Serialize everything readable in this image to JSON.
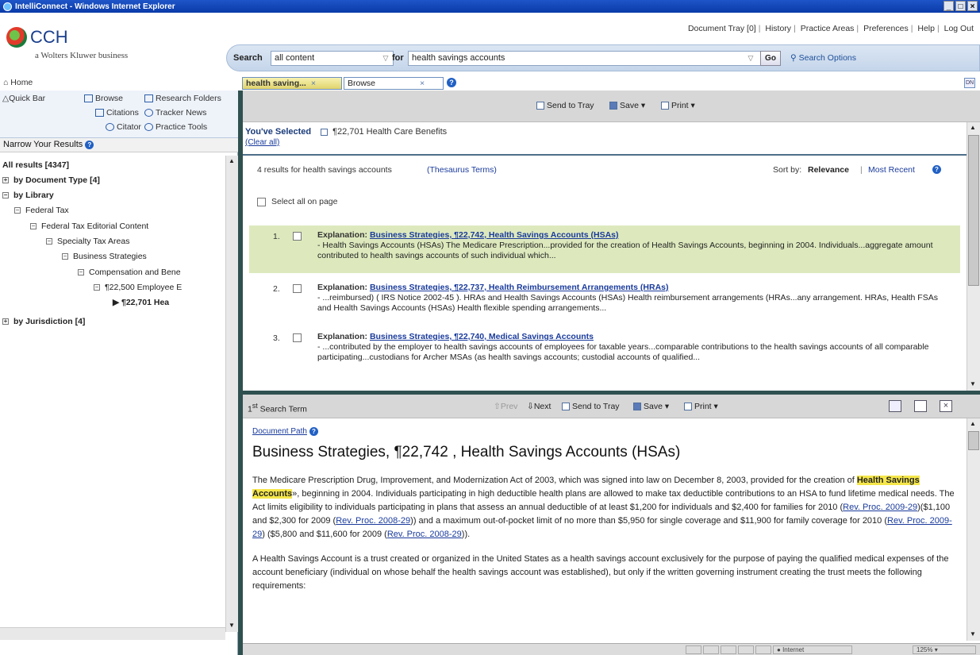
{
  "window": {
    "title": "IntelliConnect - Windows Internet Explorer"
  },
  "header": {
    "logo_text": "CCH",
    "logo_sub": "a Wolters Kluwer business",
    "links": [
      "Document Tray [0]",
      "History",
      "Practice Areas",
      "Preferences",
      "Help",
      "Log Out"
    ]
  },
  "search": {
    "label_search": "Search",
    "scope_value": "all content",
    "label_for": "for",
    "query_value": "health savings accounts",
    "go_label": "Go",
    "options_label": "Search Options"
  },
  "nav": {
    "home_label": "Home",
    "tabs": [
      {
        "label": "health saving...",
        "close": "×"
      },
      {
        "label": "Browse",
        "close": "×"
      }
    ]
  },
  "quickbar": {
    "title": "Quick Bar",
    "items": [
      "Browse",
      "Research Folders",
      "Citations",
      "Tracker News",
      "Citator",
      "Practice Tools"
    ]
  },
  "narrow": {
    "title": "Narrow Your Results",
    "tree": [
      {
        "label": "All results [4347]",
        "level": 0,
        "bold": true
      },
      {
        "label": "by Document Type [4]",
        "level": 0,
        "bold": true,
        "box": "+"
      },
      {
        "label": "by Library",
        "level": 0,
        "bold": true,
        "box": "−"
      },
      {
        "label": "Federal Tax",
        "level": 1,
        "box": "−"
      },
      {
        "label": "Federal Tax Editorial Content",
        "level": 2,
        "box": "−"
      },
      {
        "label": "Specialty Tax Areas",
        "level": 3,
        "box": "−"
      },
      {
        "label": "Business Strategies",
        "level": 4,
        "box": "−"
      },
      {
        "label": "Compensation and Bene",
        "level": 5,
        "box": "−"
      },
      {
        "label": "¶22,500 Employee E",
        "level": 6,
        "box": "−"
      },
      {
        "label": "¶22,701 Hea",
        "level": 7,
        "bold": true,
        "arrow": true
      },
      {
        "label": "by Jurisdiction [4]",
        "level": 0,
        "bold": true,
        "box": "+"
      }
    ]
  },
  "results_toolbar": {
    "send_to_tray": "Send to Tray",
    "save": "Save ▾",
    "print": "Print ▾"
  },
  "selected": {
    "label": "You've Selected",
    "value": "¶22,701 Health Care Benefits",
    "clear": "(Clear all)"
  },
  "results": {
    "summary": "4 results for health savings accounts",
    "thesaurus": "(Thesaurus Terms)",
    "sort_label": "Sort by:",
    "sort_relevance": "Relevance",
    "sort_recent": "Most Recent",
    "select_all": "Select all on page",
    "items": [
      {
        "num": "1.",
        "type": "Explanation:",
        "title": "Business Strategies, ¶22,742, Health Savings Accounts (HSAs)",
        "snippet": "- Health Savings Accounts (HSAs) The Medicare Prescription...provided for the creation of Health Savings Accounts, beginning in 2004. Individuals...aggregate amount contributed to health savings accounts of such individual which..."
      },
      {
        "num": "2.",
        "type": "Explanation:",
        "title": "Business Strategies, ¶22,737, Health Reimbursement Arrangements (HRAs)",
        "snippet": "- ...reimbursed) ( IRS Notice 2002-45 ). HRAs and Health Savings Accounts (HSAs) Health reimbursement arrangements (HRAs...any arrangement. HRAs, Health FSAs and Health Savings Accounts (HSAs) Health flexible spending arrangements..."
      },
      {
        "num": "3.",
        "type": "Explanation:",
        "title": "Business Strategies, ¶22,740, Medical Savings Accounts",
        "snippet": "- ...contributed by the employer to health savings accounts of employees for taxable years...comparable contributions to the health savings accounts of all comparable participating...custodians for Archer MSAs (as health savings accounts; custodial accounts of qualified..."
      }
    ]
  },
  "doc_toolbar": {
    "term_label": "1st Search Term",
    "prev": "Prev",
    "next": "Next",
    "send_to_tray": "Send to Tray",
    "save": "Save ▾",
    "print": "Print ▾"
  },
  "document": {
    "path_label": "Document Path",
    "title": "Business Strategies, ¶22,742 , Health Savings Accounts (HSAs)",
    "p1_a": "The Medicare Prescription Drug, Improvement, and Modernization Act of 2003, which was signed into law on December 8, 2003, provided for the creation of ",
    "p1_term": "Health Savings Accounts",
    "p1_b": "», beginning in 2004. Individuals participating in high deductible health plans are allowed to make tax deductible contributions to an HSA to fund lifetime medical needs. The Act limits eligibility to individuals participating in plans that assess an annual deductible of at least $1,200 for individuals and $2,400 for families for 2010 (",
    "p1_link1": "Rev. Proc. 2009-29",
    "p1_c": ")($1,100 and $2,300 for 2009 (",
    "p1_link2": "Rev. Proc. 2008-29",
    "p1_d": ")) and a maximum out-of-pocket limit of no more than $5,950 for single coverage and $11,900 for family coverage for 2010 (",
    "p1_link3": "Rev. Proc. 2009-29",
    "p1_e": ") ($5,800 and $11,600 for 2009 (",
    "p1_link4": "Rev. Proc. 2008-29",
    "p1_f": ")).",
    "p2": "A Health Savings Account is a trust created or organized in the United States as a health savings account exclusively for the purpose of paying the qualified medical expenses of the account beneficiary (individual on whose behalf the health savings account was established), but only if the written governing instrument creating the trust meets the following requirements:"
  },
  "status": {
    "zone": "Internet",
    "zoom": "125%"
  },
  "colors": {
    "accent": "#2f5150",
    "highlight": "#f5e64a",
    "result_hl": "#dde9bd",
    "link": "#1a3b9c"
  }
}
